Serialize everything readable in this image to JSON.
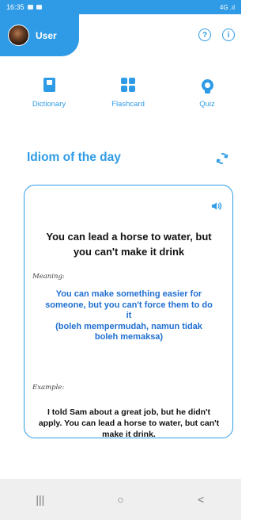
{
  "status_bar": {
    "time": "16:35",
    "right": "4G .ıl"
  },
  "header": {
    "user_name": "User",
    "help_icon": "question-circle-icon",
    "info_icon": "info-circle-icon"
  },
  "nav": [
    {
      "label": "Dictionary",
      "icon": "book-icon"
    },
    {
      "label": "Flashcard",
      "icon": "grid-icon"
    },
    {
      "label": "Quiz",
      "icon": "bulb-icon"
    }
  ],
  "section": {
    "title": "Idiom of the day",
    "refresh_icon": "refresh-icon"
  },
  "card": {
    "speaker_icon": "speaker-icon",
    "idiom_line1": "You can lead a horse to water, but",
    "idiom_line2": "you can't make it drink",
    "meaning_label": "Meaning:",
    "meaning_en_line1": "You can make something easier for",
    "meaning_en_line2": "someone, but you can't force them to do",
    "meaning_en_line3": "it",
    "meaning_id_line1": "(boleh mempermudah, namun tidak",
    "meaning_id_line2": "boleh memaksa)",
    "example_label": "Example:",
    "example_line1": "I told Sam about a great job, but he didn't",
    "example_line2": "apply. You can lead a horse to water, but can't",
    "example_line3": "make it drink."
  },
  "system_nav": {
    "recents": "|||",
    "home": "○",
    "back": "<"
  },
  "colors": {
    "accent": "#2f9be6",
    "meaning_text": "#1f6fd0"
  }
}
